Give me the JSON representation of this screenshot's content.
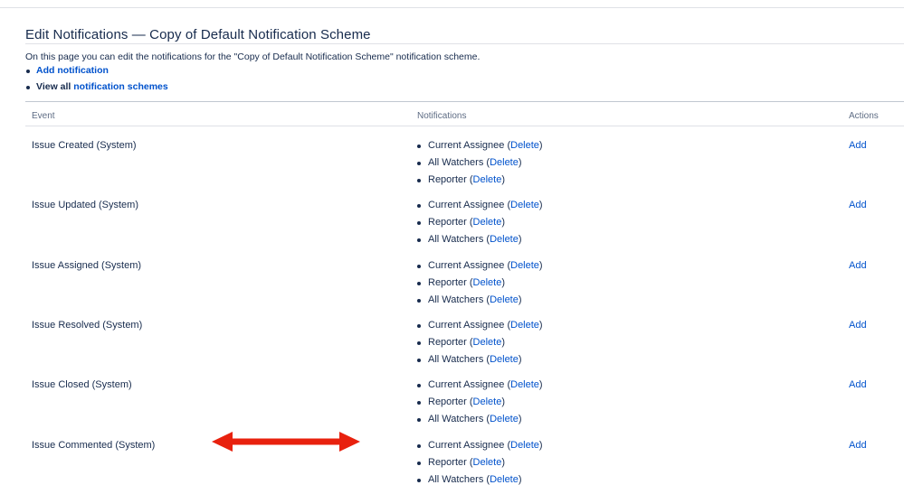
{
  "page": {
    "title": "Edit Notifications — Copy of Default Notification Scheme",
    "description": "On this page you can edit the notifications for the \"Copy of Default Notification Scheme\" notification scheme.",
    "add_notification_label": "Add notification",
    "view_all_prefix": "View all",
    "notification_schemes_label": "notification schemes"
  },
  "table": {
    "headers": {
      "event": "Event",
      "notifications": "Notifications",
      "actions": "Actions"
    },
    "rows": [
      {
        "event": "Issue Created (System)",
        "notifications": [
          {
            "name": "Current Assignee",
            "delete": "Delete"
          },
          {
            "name": "All Watchers",
            "delete": "Delete"
          },
          {
            "name": "Reporter",
            "delete": "Delete"
          }
        ],
        "action": "Add"
      },
      {
        "event": "Issue Updated (System)",
        "notifications": [
          {
            "name": "Current Assignee",
            "delete": "Delete"
          },
          {
            "name": "Reporter",
            "delete": "Delete"
          },
          {
            "name": "All Watchers",
            "delete": "Delete"
          }
        ],
        "action": "Add"
      },
      {
        "event": "Issue Assigned (System)",
        "notifications": [
          {
            "name": "Current Assignee",
            "delete": "Delete"
          },
          {
            "name": "Reporter",
            "delete": "Delete"
          },
          {
            "name": "All Watchers",
            "delete": "Delete"
          }
        ],
        "action": "Add"
      },
      {
        "event": "Issue Resolved (System)",
        "notifications": [
          {
            "name": "Current Assignee",
            "delete": "Delete"
          },
          {
            "name": "Reporter",
            "delete": "Delete"
          },
          {
            "name": "All Watchers",
            "delete": "Delete"
          }
        ],
        "action": "Add"
      },
      {
        "event": "Issue Closed (System)",
        "notifications": [
          {
            "name": "Current Assignee",
            "delete": "Delete"
          },
          {
            "name": "Reporter",
            "delete": "Delete"
          },
          {
            "name": "All Watchers",
            "delete": "Delete"
          }
        ],
        "action": "Add"
      },
      {
        "event": "Issue Commented (System)",
        "notifications": [
          {
            "name": "Current Assignee",
            "delete": "Delete"
          },
          {
            "name": "Reporter",
            "delete": "Delete"
          },
          {
            "name": "All Watchers",
            "delete": "Delete"
          }
        ],
        "action": "Add"
      }
    ]
  },
  "annotation": {
    "arrow_icon": "double-headed-arrow-icon",
    "arrow_color": "#e8210e"
  },
  "colors": {
    "link": "#0052cc",
    "text": "#172b4d",
    "muted": "#5e6c84"
  }
}
